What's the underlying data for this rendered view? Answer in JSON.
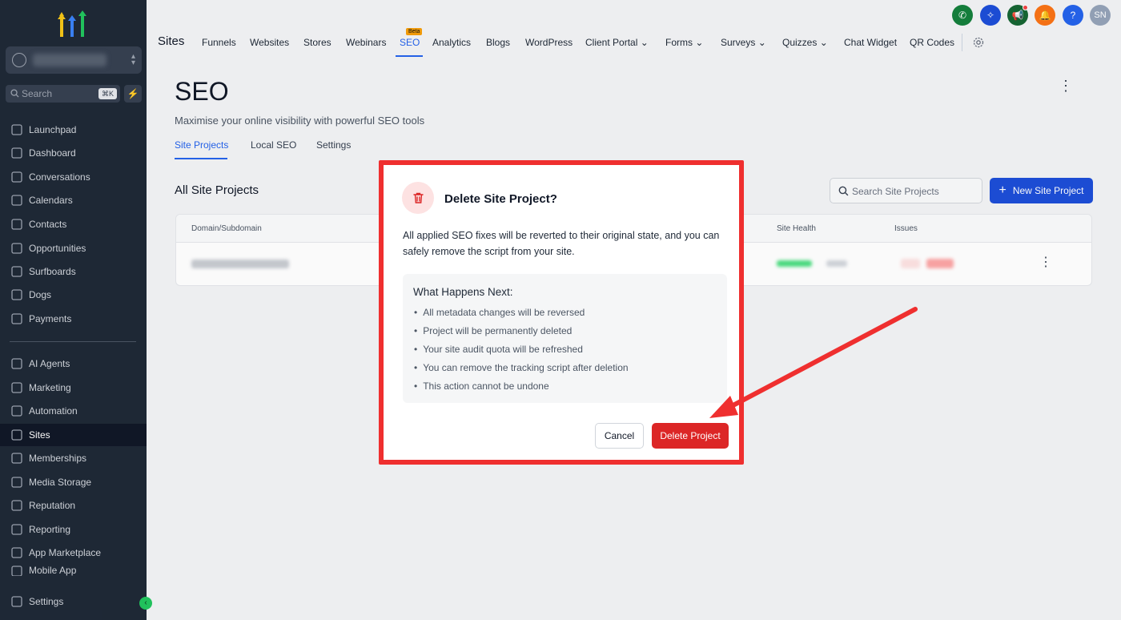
{
  "sidebar": {
    "search_placeholder": "Search",
    "search_shortcut": "⌘K",
    "items": [
      {
        "label": "Launchpad",
        "icon": "rocket-icon"
      },
      {
        "label": "Dashboard",
        "icon": "grid-icon"
      },
      {
        "label": "Conversations",
        "icon": "chat-icon"
      },
      {
        "label": "Calendars",
        "icon": "calendar-icon"
      },
      {
        "label": "Contacts",
        "icon": "contact-icon"
      },
      {
        "label": "Opportunities",
        "icon": "funnel-icon"
      },
      {
        "label": "Surfboards",
        "icon": "surfboard-icon"
      },
      {
        "label": "Dogs",
        "icon": "paw-icon"
      },
      {
        "label": "Payments",
        "icon": "receipt-icon"
      },
      {
        "label": "AI Agents",
        "icon": "sparkle-icon"
      },
      {
        "label": "Marketing",
        "icon": "send-icon"
      },
      {
        "label": "Automation",
        "icon": "automation-icon"
      },
      {
        "label": "Sites",
        "icon": "sites-icon"
      },
      {
        "label": "Memberships",
        "icon": "badge-icon"
      },
      {
        "label": "Media Storage",
        "icon": "image-icon"
      },
      {
        "label": "Reputation",
        "icon": "star-icon"
      },
      {
        "label": "Reporting",
        "icon": "chart-line-icon"
      },
      {
        "label": "App Marketplace",
        "icon": "apps-icon"
      },
      {
        "label": "Mobile App",
        "icon": "mobile-icon"
      },
      {
        "label": "Settings",
        "icon": "settings-icon"
      }
    ],
    "active": "Sites"
  },
  "topnav": {
    "title": "Sites",
    "links": [
      "Funnels",
      "Websites",
      "Stores",
      "Webinars",
      "SEO",
      "Analytics",
      "Blogs",
      "WordPress",
      "Client Portal",
      "Forms",
      "Surveys",
      "Quizzes",
      "Chat Widget",
      "QR Codes"
    ],
    "active": "SEO",
    "beta_label": "Beta",
    "avatar_initials": "SN"
  },
  "page": {
    "title": "SEO",
    "subtitle": "Maximise your online visibility with powerful SEO tools",
    "tabs": [
      "Site Projects",
      "Local SEO",
      "Settings"
    ],
    "active_tab": "Site Projects",
    "section_title": "All Site Projects",
    "search_placeholder": "Search Site Projects",
    "new_button": "New Site Project",
    "columns": [
      "Domain/Subdomain",
      "Site Health",
      "Issues"
    ]
  },
  "modal": {
    "title": "Delete Site Project?",
    "description": "All applied SEO fixes will be reverted to their original state, and you can safely remove the script from your site.",
    "next_title": "What Happens Next:",
    "next_items": [
      "All metadata changes will be reversed",
      "Project will be permanently deleted",
      "Your site audit quota will be refreshed",
      "You can remove the tracking script after deletion",
      "This action cannot be undone"
    ],
    "cancel_label": "Cancel",
    "delete_label": "Delete Project"
  },
  "colors": {
    "sidebar_bg": "#1f2937",
    "accent": "#2563eb",
    "danger": "#dc2626",
    "highlight_frame": "#ef2f2f"
  }
}
